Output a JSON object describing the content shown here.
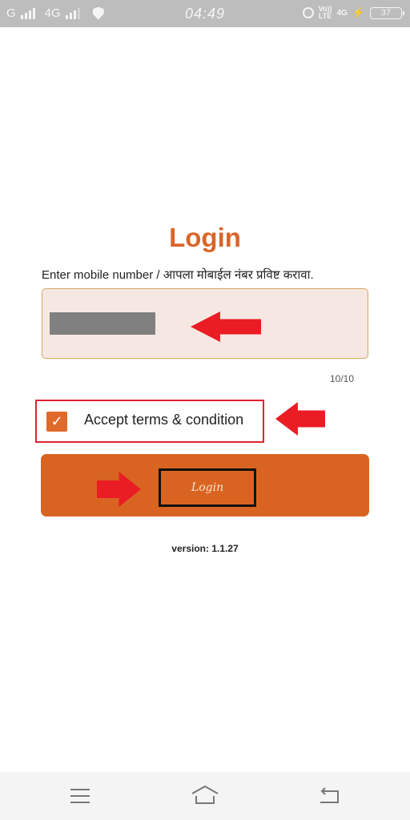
{
  "status_bar": {
    "network_left": "G",
    "network_mid": "4G",
    "time": "04:49",
    "volte_top": "Vo))",
    "volte_bottom": "LTE",
    "network_right": "4G",
    "battery": "37",
    "bolt": "⚡",
    "icons": [
      "signal-icon",
      "shield-icon",
      "alarm-icon",
      "volte-icon",
      "charging-icon",
      "battery-icon"
    ]
  },
  "login": {
    "title": "Login",
    "prompt": "Enter mobile number / आपला मोबाईल नंबर प्रविष्ट करावा.",
    "phone_value_masked": true,
    "char_counter": "10/10",
    "terms_label": "Accept terms & condition",
    "terms_checked": true,
    "checkmark": "✓",
    "button_label": "Login",
    "version": "version: 1.1.27"
  },
  "annotations": {
    "arrow_color": "#ea1c24",
    "highlight_color": "#e02030"
  },
  "colors": {
    "accent": "#d96421",
    "field_bg": "#f5e8e2",
    "field_border": "#d8a860"
  },
  "nav_bar": {
    "items": [
      "menu",
      "home",
      "back"
    ]
  }
}
